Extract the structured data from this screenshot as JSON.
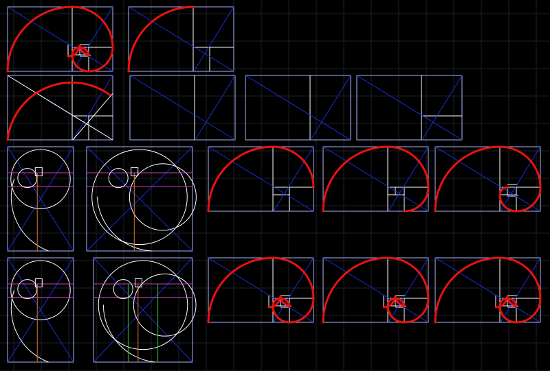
{
  "colors": {
    "background": "#000000",
    "grid": "#1c1f26",
    "frame": "#aab4ff",
    "line": "#ffffff",
    "diagonal": "#1a2dd8",
    "spiral": "#e8130f",
    "orange": "#d9772e",
    "magenta": "#c43cc4",
    "green": "#2fc12f"
  },
  "diagram": {
    "panels": [
      {
        "kind": "spiral-full"
      },
      {
        "kind": "spiral-arc"
      },
      {
        "kind": "spiral-arc-white-diagonals"
      },
      {
        "kind": "rectangle-division"
      },
      {
        "kind": "rectangle-division"
      },
      {
        "kind": "rectangle-division"
      },
      {
        "kind": "tall-circles"
      },
      {
        "kind": "tall-double-circles"
      },
      {
        "kind": "tall-circles-b"
      },
      {
        "kind": "tall-double-circles-green"
      },
      {
        "kind": "spiral-quarter"
      },
      {
        "kind": "spiral-two-arcs"
      },
      {
        "kind": "spiral-deep"
      },
      {
        "kind": "spiral-full"
      },
      {
        "kind": "spiral-full"
      },
      {
        "kind": "spiral-full"
      }
    ]
  }
}
